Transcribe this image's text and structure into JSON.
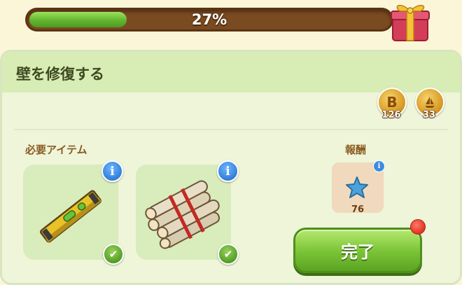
{
  "progress": {
    "percent_label": "27%",
    "fraction": 0.27
  },
  "gift_icon": "gift-box-icon",
  "panel": {
    "title": "壁を修復する"
  },
  "currencies": [
    {
      "icon": "coin-b-icon",
      "value": "126"
    },
    {
      "icon": "coin-boat-icon",
      "value": "33"
    }
  ],
  "required": {
    "label": "必要アイテム",
    "items": [
      {
        "icon": "spirit-level-icon",
        "info": "i",
        "status": "✔"
      },
      {
        "icon": "log-bundle-icon",
        "info": "i",
        "status": "✔"
      }
    ]
  },
  "reward": {
    "label": "報酬",
    "icon": "blue-star-icon",
    "info": "i",
    "value": "76"
  },
  "button": {
    "label": "完了"
  },
  "colors": {
    "accent_green": "#7dc63a",
    "progress_brown": "#7a4a21",
    "label_brown": "#8b5a20"
  }
}
